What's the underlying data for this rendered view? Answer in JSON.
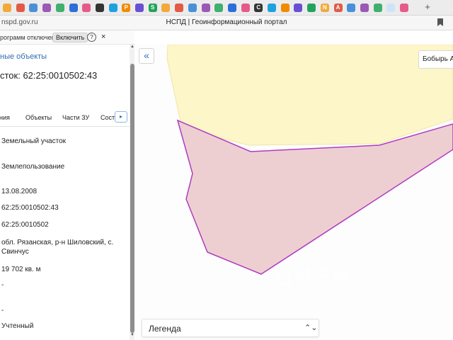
{
  "browser": {
    "url": "nspd.gov.ru",
    "page_title": "НСПД | Геоинформационный портал",
    "favicons": [
      "chart-icon",
      "arch-icon",
      "cloud-icon",
      "doc-icon",
      "globe-icon",
      "circle-icon",
      "tiles-icon",
      "sword-icon",
      "wave-icon",
      "p-icon",
      "image-icon",
      "s-icon",
      "orange-icon",
      "purple-icon",
      "telegram-icon",
      "whale-icon",
      "leaf-icon",
      "bars-icon",
      "cal-icon",
      "c-icon",
      "m-icon",
      "whatsapp-icon",
      "green-icon",
      "bag-icon",
      "notion-icon",
      "a-icon",
      "box-icon",
      "camera-icon",
      "gear-icon",
      "active-tab-icon",
      "doc2-icon"
    ],
    "favicon_letters": {
      "p-icon": "P",
      "s-icon": "S",
      "c-icon": "C",
      "notion-icon": "N",
      "a-icon": "A"
    },
    "new_tab_label": "+"
  },
  "notification": {
    "text": "рограмм отключена",
    "enable_label": "Включить",
    "help_label": "?",
    "close_label": "×"
  },
  "panel": {
    "back_link": "ные объекты",
    "title": "сток: 62:25:0010502:43",
    "tabs": [
      "ения",
      "Объекты",
      "Части ЗУ",
      "Соста"
    ],
    "tab_next_label": "▸",
    "fields": [
      "Земельный участок",
      "Землепользование",
      "13.08.2008",
      "62:25:0010502:43",
      "62:25:0010502",
      "обл. Рязанская, р-н Шиловский, с. Свинчус",
      "19 702 кв. м",
      "-",
      "-",
      "Учтенный"
    ]
  },
  "map": {
    "collapse_label": "«",
    "search_chip": "Бобырь А",
    "legend_label": "Легенда",
    "legend_chevron": "⌃⌄",
    "watermark": "циан",
    "colors": {
      "yellow_fill": "#fcf6c8",
      "yellow_stroke": "#f0e6a8",
      "parcel_fill": "#edcfd2",
      "parcel_stroke": "#b03cc0"
    }
  }
}
